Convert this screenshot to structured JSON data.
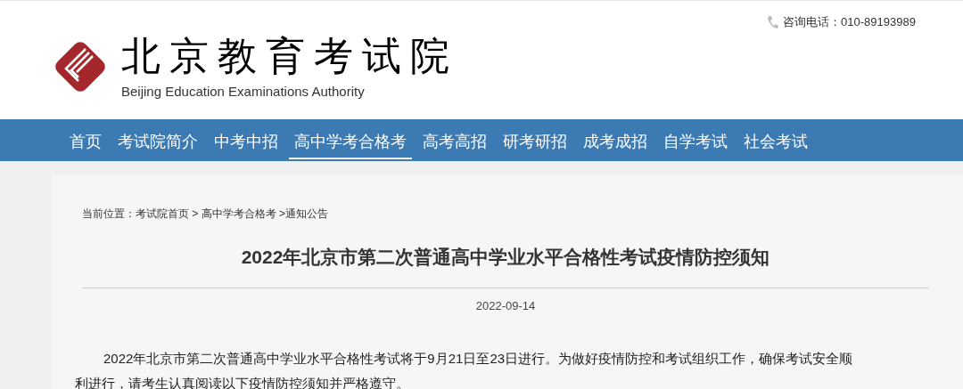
{
  "header": {
    "logo_title": "北京教育考试院",
    "logo_subtitle": "Beijing Education Examinations Authority",
    "hotline": "咨询电话：010-89193989"
  },
  "nav": [
    {
      "label": "首页",
      "selected": false
    },
    {
      "label": "考试院简介",
      "selected": false
    },
    {
      "label": "中考中招",
      "selected": false
    },
    {
      "label": "高中学考合格考",
      "selected": true
    },
    {
      "label": "高考高招",
      "selected": false
    },
    {
      "label": "研考研招",
      "selected": false
    },
    {
      "label": "成考成招",
      "selected": false
    },
    {
      "label": "自学考试",
      "selected": false
    },
    {
      "label": "社会考试",
      "selected": false
    }
  ],
  "breadcrumb": "当前位置：考试院首页 > 高中学考合格考 >通知公告",
  "article": {
    "title": "2022年北京市第二次普通高中学业水平合格性考试疫情防控须知",
    "date": "2022-09-14",
    "body": "2022年北京市第二次普通高中学业水平合格性考试将于9月21日至23日进行。为做好疫情防控和考试组织工作，确保考试安全顺利进行，请考生认真阅读以下疫情防控须知并严格遵守。"
  }
}
